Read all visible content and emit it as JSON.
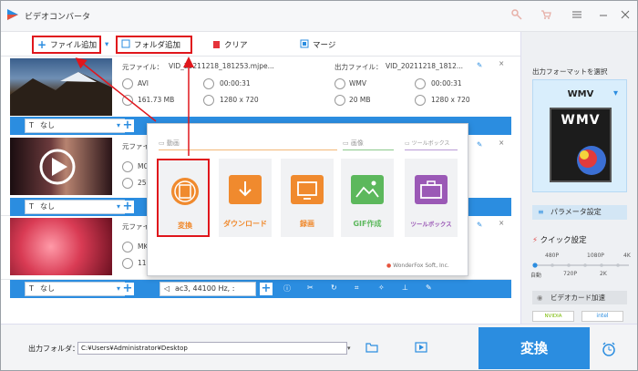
{
  "app": {
    "title": "ビデオコンバータ"
  },
  "toolbar": {
    "add_file": "ファイル追加",
    "add_folder": "フォルダ追加",
    "clear": "クリア",
    "merge": "マージ"
  },
  "files": [
    {
      "source_label": "元ファイル：",
      "source_name": "VID_20211218_181253.mjpe...",
      "src_format": "AVI",
      "src_duration": "00:00:31",
      "src_size": "161.73 MB",
      "src_res": "1280 x 720",
      "output_label": "出力ファイル：",
      "output_name": "VID_20211218_1812...",
      "out_format": "WMV",
      "out_duration": "00:00:31",
      "out_size": "20 MB",
      "out_res": "1280 x 720",
      "subtitle": "なし"
    },
    {
      "source_label": "元ファイル：",
      "src_format": "MO",
      "src_size": "25",
      "subtitle": "なし"
    },
    {
      "source_label": "元ファイル：",
      "src_format": "MK",
      "src_size": "11",
      "subtitle": "なし",
      "audio": "ac3, 44100 Hz, :"
    }
  ],
  "popup": {
    "section_video": "動画",
    "section_image": "画像",
    "section_toolbox": "ツールボックス",
    "items": [
      {
        "label": "変換",
        "color": "#f08a2e"
      },
      {
        "label": "ダウンロード",
        "color": "#f08a2e"
      },
      {
        "label": "録画",
        "color": "#f08a2e"
      },
      {
        "label": "GIF作成",
        "color": "#5cb85c"
      },
      {
        "label": "ツールボックス",
        "color": "#9b59b6"
      }
    ],
    "brand": "WonderFox Soft, Inc."
  },
  "right": {
    "format_heading": "出力フォーマットを選択",
    "format_value": "WMV",
    "format_badge": "WMV",
    "param_button": "パラメータ設定",
    "quick_heading": "クイック設定",
    "quality_top": [
      "480P",
      "1080P",
      "4K"
    ],
    "quality_bottom": [
      "自動",
      "720P",
      "2K"
    ],
    "gpu_heading": "ビデオカード加速",
    "gpu_nvidia": "NVIDIA",
    "gpu_intel": "intel"
  },
  "bottom": {
    "folder_label": "出力フォルダ：",
    "folder_path": "C:¥Users¥Administrator¥Desktop",
    "convert": "変換"
  }
}
